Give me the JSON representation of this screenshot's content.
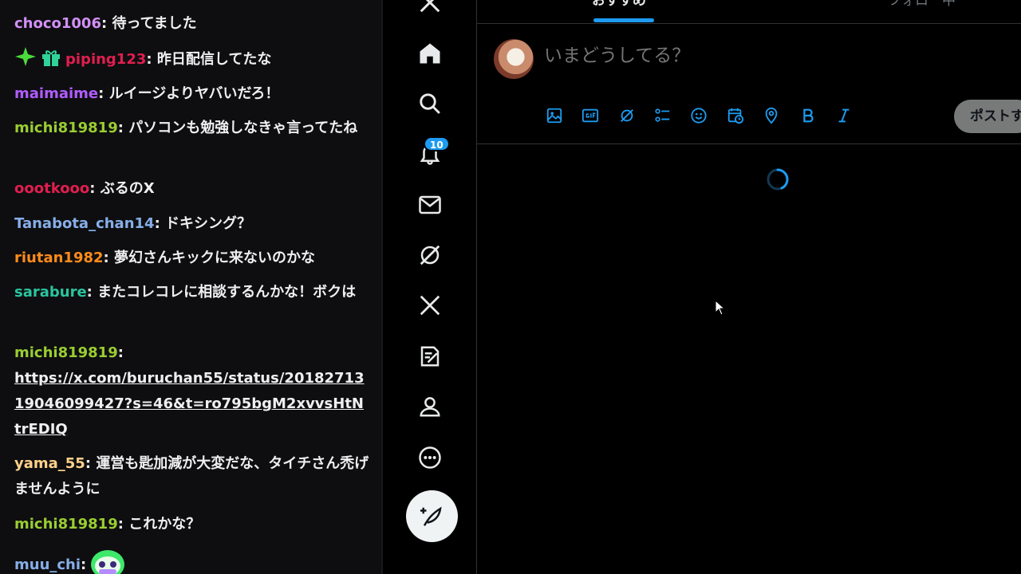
{
  "chat": {
    "messages": [
      {
        "user": "choco1006",
        "color": "#d290f6",
        "text": "待ってました"
      },
      {
        "user": "piping123",
        "color": "#e01e4f",
        "text": "昨日配信してたな",
        "badges": [
          "sparkle-badge",
          "gift-badge"
        ]
      },
      {
        "user": "maimaime",
        "color": "#b05cff",
        "text": "ルイージよりヤバいだろ！"
      },
      {
        "user": "michi819819",
        "color": "#9acd32",
        "text": "パソコンも勉強しなきゃ言ってたね"
      },
      {
        "user": "oootkooo",
        "color": "#e01e4f",
        "text": "ぶるのX"
      },
      {
        "user": "Tanabota_chan14",
        "color": "#87aee8",
        "text": "ドキシング？"
      },
      {
        "user": "riutan1982",
        "color": "#ff8c1a",
        "text": "夢幻さんキックに来ないのかな"
      },
      {
        "user": "sarabure",
        "color": "#2ac49f",
        "text": "またコレコレに相談するんかな！ボクは"
      },
      {
        "user": "michi819819",
        "color": "#9acd32",
        "link": "https://x.com/buruchan55/status/2018271319046099427?s=46&t=ro795bgM2xvvsHtNtrEDIQ"
      },
      {
        "user": "yama_55",
        "color": "#ffd28a",
        "text": "運営も匙加減が大変だな、タイチさん禿げませんように"
      },
      {
        "user": "michi819819",
        "color": "#9acd32",
        "text": "これかな？"
      },
      {
        "user": "muu_chi",
        "color": "#87aee8",
        "text": "",
        "emote": "green-ghost-emote"
      }
    ]
  },
  "nav": {
    "notification_count": "10",
    "items": [
      "x-logo-icon",
      "home-icon",
      "search-icon",
      "bell-icon",
      "mail-icon",
      "grok-icon",
      "x-premium-icon",
      "lists-icon",
      "profile-icon",
      "more-icon"
    ]
  },
  "main": {
    "tabs": [
      {
        "label": "おすすめ"
      },
      {
        "label": "フォロー中"
      }
    ],
    "composer": {
      "placeholder": "いまどうしてる？",
      "post_label": "ポストする"
    }
  },
  "colors": {
    "accent": "#1d9bf0",
    "border": "#2f3336",
    "chat_bg": "#0e0e10"
  }
}
